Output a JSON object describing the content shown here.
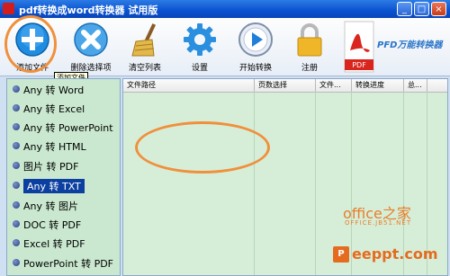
{
  "window": {
    "title": "pdf转换成word转换器 试用版",
    "minimize": "_",
    "maximize": "□",
    "close": "×"
  },
  "toolbar": {
    "buttons": [
      {
        "label": "添加文件",
        "icon": "add-icon"
      },
      {
        "label": "删除选择项",
        "icon": "delete-icon"
      },
      {
        "label": "清空列表",
        "icon": "broom-icon"
      },
      {
        "label": "设置",
        "icon": "gear-icon"
      },
      {
        "label": "开始转换",
        "icon": "play-icon"
      },
      {
        "label": "注册",
        "icon": "lock-icon"
      }
    ],
    "brand": "PFD万能转换器",
    "brand_icon_text": "PDF"
  },
  "tooltip": "添加文件",
  "conversions": {
    "items": [
      "Any 转 Word",
      "Any 转 Excel",
      "Any 转 PowerPoint",
      "Any 转 HTML",
      "图片 转 PDF",
      "Any 转 TXT",
      "Any 转 图片",
      "DOC 转 PDF",
      "Excel 转 PDF",
      "PowerPoint 转 PDF"
    ],
    "selected": "Any 转 TXT"
  },
  "file_list": {
    "columns": [
      "文件路径",
      "页数选择",
      "文件...",
      "转换进度",
      "总..."
    ]
  },
  "watermark": {
    "site1": "office之家",
    "site1_url": "OFFICE.JB51.NET",
    "site2_logo": "P",
    "site2": "eeppt.com"
  },
  "colors": {
    "accent_highlight": "#f0903c",
    "title_bar": "#0a52d0",
    "selected_item": "#0b3fa0"
  }
}
